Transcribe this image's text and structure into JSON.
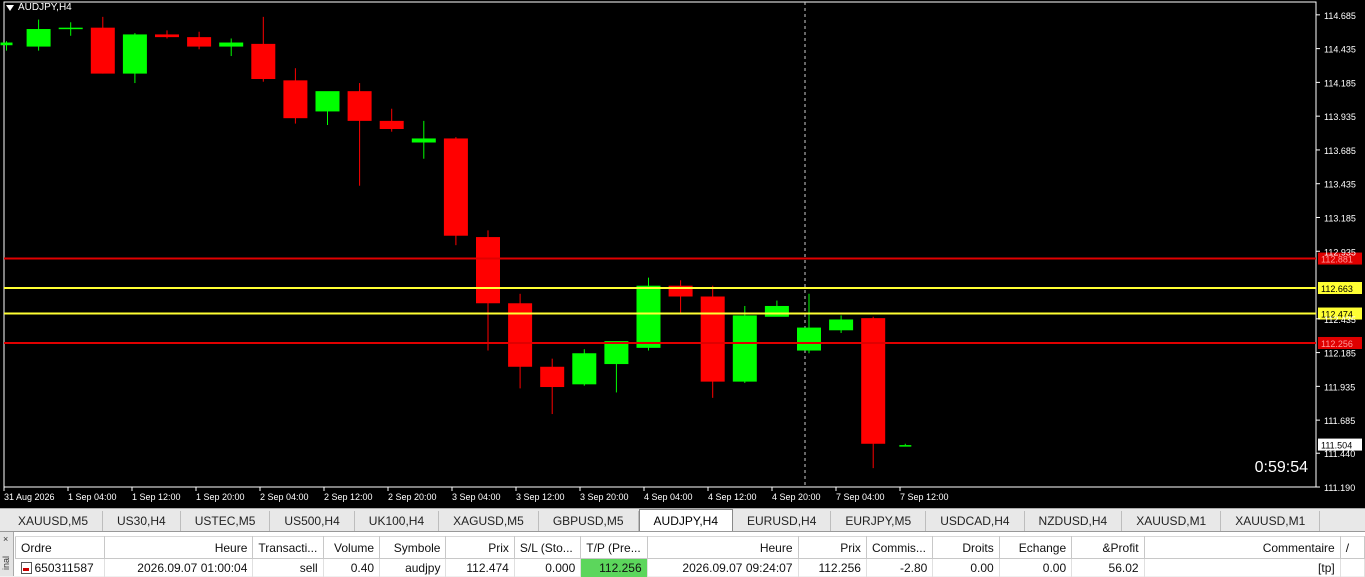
{
  "window": {
    "title": "AUDJPY,H4"
  },
  "countdown": "0:59:54",
  "colors": {
    "bull": "#00ff00",
    "bear": "#ff0000",
    "level_red": "#e00000",
    "level_yellow": "#ffff33",
    "background": "#000000",
    "axis_text": "#ffffff"
  },
  "chart_data": {
    "type": "candlestick",
    "symbol": "AUDJPY",
    "timeframe": "H4",
    "y_ticks": [
      "114.685",
      "114.435",
      "114.185",
      "113.935",
      "113.685",
      "113.435",
      "113.185",
      "112.935",
      "112.435",
      "112.185",
      "111.935",
      "111.685",
      "111.440",
      "111.190"
    ],
    "ylim": [
      111.19,
      114.78
    ],
    "x_ticks": [
      "31 Aug 2026",
      "1 Sep 04:00",
      "1 Sep 12:00",
      "1 Sep 20:00",
      "2 Sep 04:00",
      "2 Sep 12:00",
      "2 Sep 20:00",
      "3 Sep 04:00",
      "3 Sep 12:00",
      "3 Sep 20:00",
      "4 Sep 04:00",
      "4 Sep 12:00",
      "4 Sep 20:00",
      "7 Sep 04:00",
      "7 Sep 12:00"
    ],
    "candles": [
      {
        "o": 114.46,
        "h": 114.49,
        "l": 114.42,
        "c": 114.48
      },
      {
        "o": 114.45,
        "h": 114.65,
        "l": 114.42,
        "c": 114.58
      },
      {
        "o": 114.58,
        "h": 114.63,
        "l": 114.53,
        "c": 114.59
      },
      {
        "o": 114.59,
        "h": 114.67,
        "l": 114.25,
        "c": 114.25
      },
      {
        "o": 114.25,
        "h": 114.55,
        "l": 114.18,
        "c": 114.54
      },
      {
        "o": 114.54,
        "h": 114.57,
        "l": 114.51,
        "c": 114.52
      },
      {
        "o": 114.52,
        "h": 114.56,
        "l": 114.43,
        "c": 114.45
      },
      {
        "o": 114.45,
        "h": 114.51,
        "l": 114.38,
        "c": 114.48
      },
      {
        "o": 114.47,
        "h": 114.67,
        "l": 114.19,
        "c": 114.21
      },
      {
        "o": 114.2,
        "h": 114.29,
        "l": 113.88,
        "c": 113.92
      },
      {
        "o": 113.97,
        "h": 114.09,
        "l": 113.87,
        "c": 114.12
      },
      {
        "o": 114.12,
        "h": 114.18,
        "l": 113.42,
        "c": 113.9
      },
      {
        "o": 113.9,
        "h": 113.99,
        "l": 113.82,
        "c": 113.84
      },
      {
        "o": 113.74,
        "h": 113.9,
        "l": 113.62,
        "c": 113.77
      },
      {
        "o": 113.77,
        "h": 113.78,
        "l": 112.98,
        "c": 113.05
      },
      {
        "o": 113.04,
        "h": 113.09,
        "l": 112.2,
        "c": 112.55
      },
      {
        "o": 112.55,
        "h": 112.62,
        "l": 111.92,
        "c": 112.08
      },
      {
        "o": 112.08,
        "h": 112.14,
        "l": 111.73,
        "c": 111.93
      },
      {
        "o": 111.95,
        "h": 112.21,
        "l": 111.94,
        "c": 112.18
      },
      {
        "o": 112.1,
        "h": 112.2,
        "l": 111.89,
        "c": 112.27
      },
      {
        "o": 112.22,
        "h": 112.74,
        "l": 112.2,
        "c": 112.68
      },
      {
        "o": 112.68,
        "h": 112.72,
        "l": 112.48,
        "c": 112.6
      },
      {
        "o": 112.6,
        "h": 112.68,
        "l": 111.85,
        "c": 111.97
      },
      {
        "o": 111.97,
        "h": 112.53,
        "l": 111.96,
        "c": 112.46
      },
      {
        "o": 112.45,
        "h": 112.57,
        "l": 112.46,
        "c": 112.53
      },
      {
        "o": 112.2,
        "h": 112.62,
        "l": 112.18,
        "c": 112.37
      },
      {
        "o": 112.35,
        "h": 112.46,
        "l": 112.33,
        "c": 112.43
      },
      {
        "o": 112.44,
        "h": 112.45,
        "l": 111.33,
        "c": 111.51
      },
      {
        "o": 111.5,
        "h": 111.51,
        "l": 111.5,
        "c": 111.5
      }
    ],
    "levels": [
      {
        "price": 112.881,
        "label": "112.881",
        "color": "red"
      },
      {
        "price": 112.663,
        "label": "112.663",
        "color": "yellow"
      },
      {
        "price": 112.474,
        "label": "112.474",
        "color": "yellow"
      },
      {
        "price": 112.256,
        "label": "112.256",
        "color": "red"
      }
    ],
    "current_price": "111.504",
    "crosshair": "4 Sep 20:00",
    "grid": false
  },
  "tabs": [
    "XAUUSD,M5",
    "US30,H4",
    "USTEC,M5",
    "US500,H4",
    "UK100,H4",
    "XAGUSD,M5",
    "GBPUSD,M5",
    "AUDJPY,H4",
    "EURUSD,H4",
    "EURJPY,M5",
    "USDCAD,H4",
    "NZDUSD,H4",
    "XAUUSD,M1",
    "XAUUSD,M1"
  ],
  "active_tab": "AUDJPY,H4",
  "terminal": {
    "side_close": "×",
    "side_label": "inal",
    "columns": [
      "Ordre",
      "Heure",
      "Transacti...",
      "Volume",
      "Symbole",
      "Prix",
      "S/L (Sto...",
      "T/P (Pre...",
      "Heure",
      "Prix",
      "Commis...",
      "Droits",
      "Echange",
      "&Profit",
      "Commentaire",
      "/"
    ],
    "rows": [
      {
        "ordre": "650311587",
        "heure": "2026.09.07 01:00:04",
        "type": "sell",
        "volume": "0.40",
        "symbole": "audjpy",
        "prix": "112.474",
        "sl": "0.000",
        "tp": "112.256",
        "heure2": "2026.09.07 09:24:07",
        "prix2": "112.256",
        "commission": "-2.80",
        "droits": "0.00",
        "echange": "0.00",
        "profit": "56.02",
        "commentaire": "[tp]"
      }
    ]
  }
}
